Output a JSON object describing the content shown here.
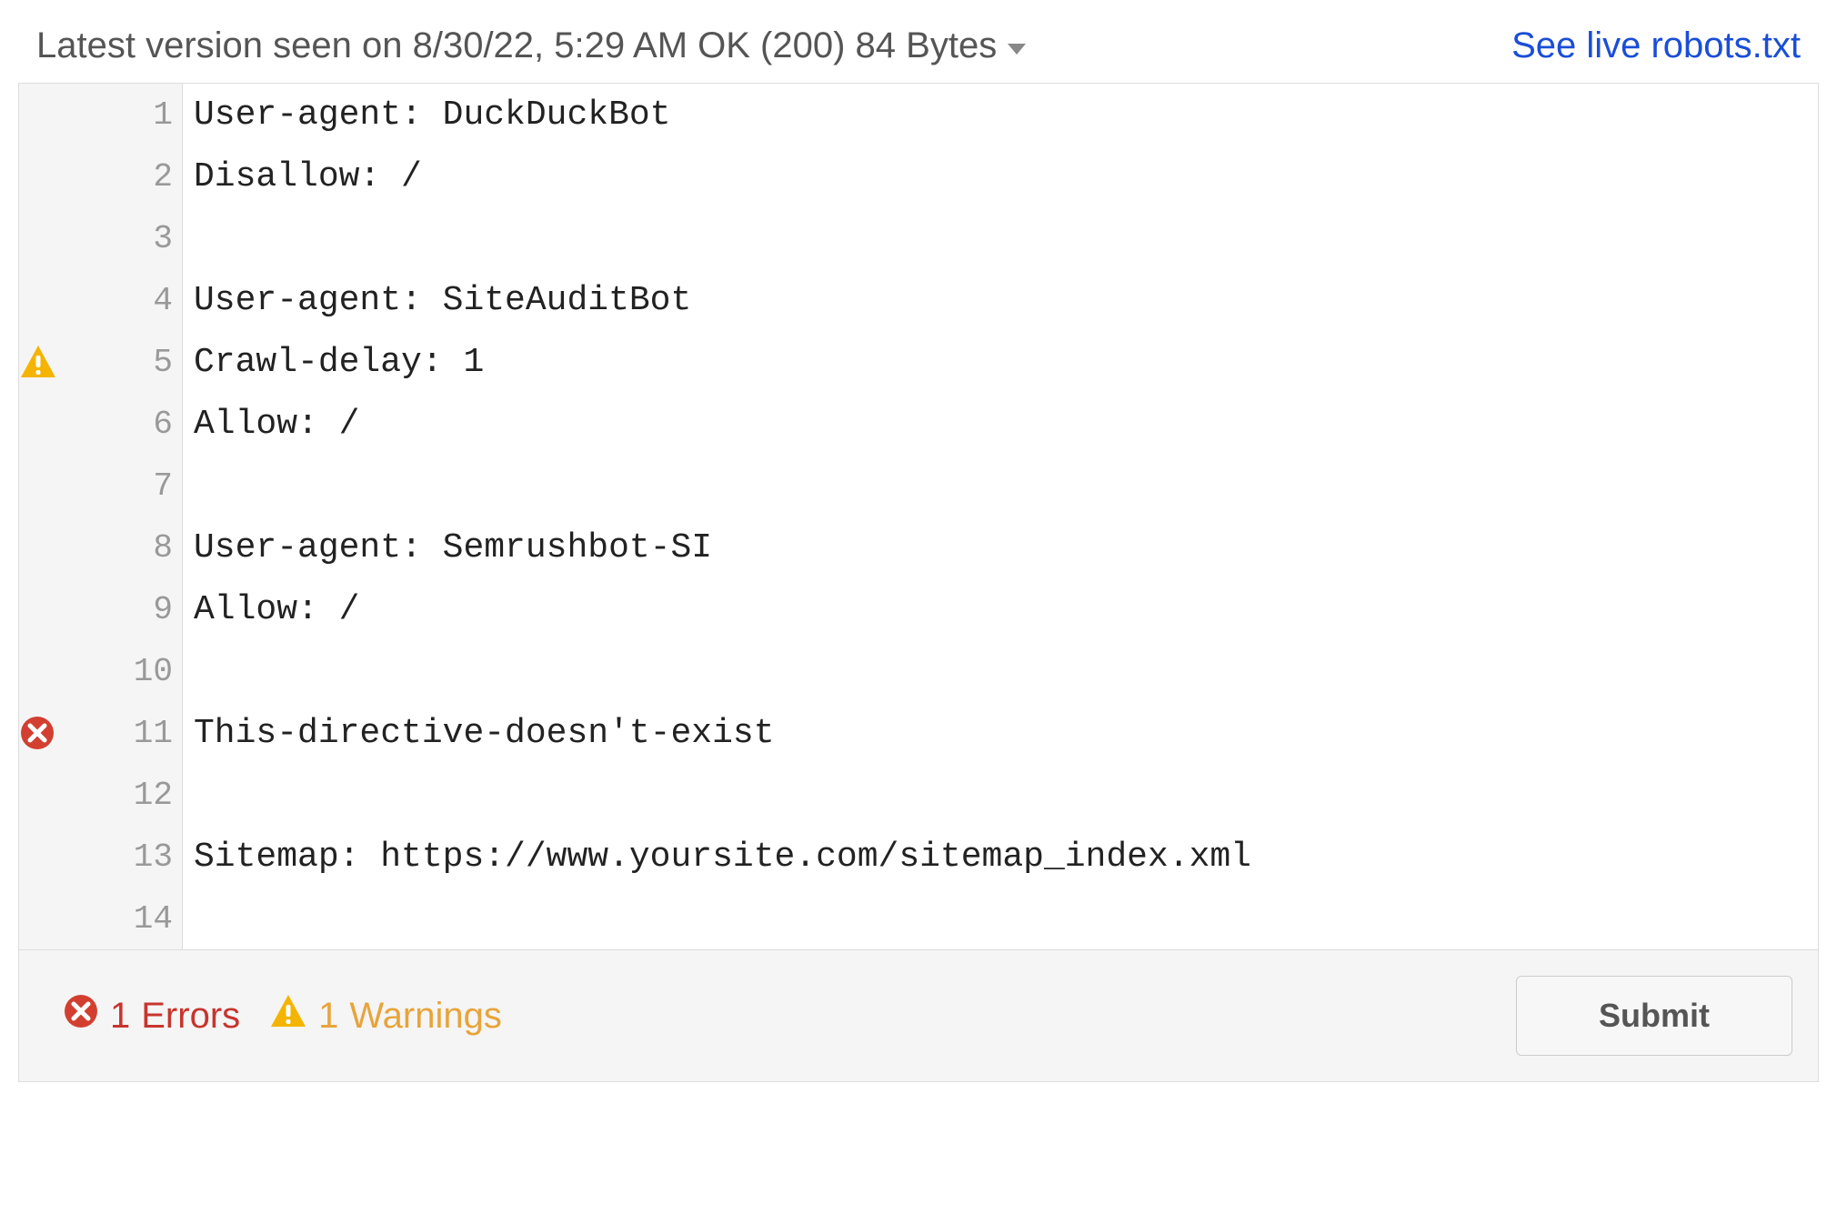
{
  "header": {
    "version_label": "Latest version seen on 8/30/22, 5:29 AM OK (200) 84 Bytes",
    "live_link_label": "See live robots.txt"
  },
  "editor": {
    "lines": [
      {
        "n": "1",
        "marker": null,
        "text": "User-agent: DuckDuckBot"
      },
      {
        "n": "2",
        "marker": null,
        "text": "Disallow: /"
      },
      {
        "n": "3",
        "marker": null,
        "text": ""
      },
      {
        "n": "4",
        "marker": null,
        "text": "User-agent: SiteAuditBot"
      },
      {
        "n": "5",
        "marker": "warning",
        "text": "Crawl-delay: 1"
      },
      {
        "n": "6",
        "marker": null,
        "text": "Allow: /"
      },
      {
        "n": "7",
        "marker": null,
        "text": ""
      },
      {
        "n": "8",
        "marker": null,
        "text": "User-agent: Semrushbot-SI"
      },
      {
        "n": "9",
        "marker": null,
        "text": "Allow: /"
      },
      {
        "n": "10",
        "marker": null,
        "text": ""
      },
      {
        "n": "11",
        "marker": "error",
        "text": "This-directive-doesn't-exist"
      },
      {
        "n": "12",
        "marker": null,
        "text": ""
      },
      {
        "n": "13",
        "marker": null,
        "text": "Sitemap: https://www.yoursite.com/sitemap_index.xml"
      },
      {
        "n": "14",
        "marker": null,
        "text": ""
      }
    ]
  },
  "footer": {
    "error_count": "1",
    "error_label": "Errors",
    "warning_count": "1",
    "warning_label": "Warnings",
    "submit_label": "Submit"
  },
  "icons": {
    "error_svg": "<svg width='40' height='40' viewBox='0 0 40 40'><circle cx='20' cy='20' r='18' fill='#d23f31'/><path d='M12 12 L28 28 M28 12 L12 28' stroke='#fff' stroke-width='5' stroke-linecap='round'/></svg>",
    "warning_svg": "<svg width='42' height='42' viewBox='0 0 42 42'><path d='M21 3 L40 38 L2 38 Z' fill='#f4b400'/><rect x='18.5' y='14' width='5' height='13' rx='2' fill='#fff'/><rect x='18.5' y='30' width='5' height='5' rx='2' fill='#fff'/></svg>"
  }
}
